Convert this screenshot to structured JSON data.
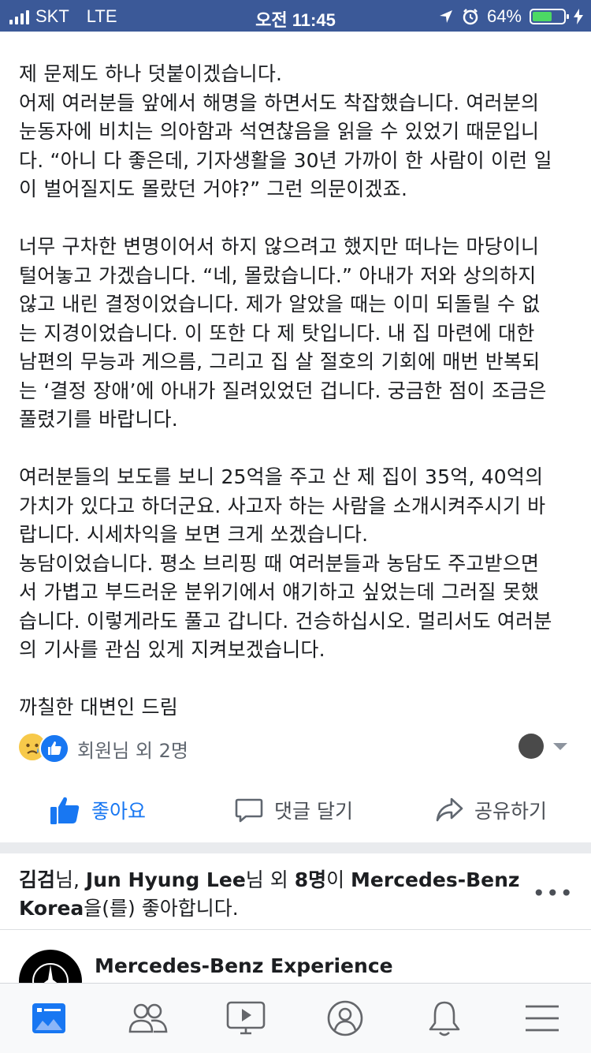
{
  "status_bar": {
    "carrier": "SKT",
    "network": "LTE",
    "time": "오전 11:45",
    "battery_percent": "64%",
    "battery_level": 0.64
  },
  "post": {
    "lines": [
      "제 문제도 하나 덧붙이겠습니다.",
      "어제 여러분들 앞에서 해명을 하면서도 착잡했습니다. 여러분의",
      "눈동자에 비치는 의아함과 석연찮음을 읽을 수 있었기 때문입니",
      "다. “아니 다 좋은데, 기자생활을 30년 가까이 한 사람이 이런 일",
      "이 벌어질지도 몰랐던 거야?” 그런 의문이겠죠.",
      "",
      "너무 구차한 변명이어서 하지 않으려고 했지만 떠나는 마당이니",
      "털어놓고 가겠습니다. “네, 몰랐습니다.” 아내가 저와 상의하지",
      "않고 내린 결정이었습니다. 제가 알았을 때는 이미 되돌릴 수 없",
      "는 지경이었습니다. 이 또한 다 제 탓입니다. 내 집 마련에 대한",
      "남편의 무능과 게으름, 그리고 집 살 절호의 기회에 매번 반복되",
      "는 ‘결정 장애’에 아내가 질려있었던 겁니다. 궁금한 점이 조금은",
      "풀렸기를 바랍니다.",
      "",
      "여러분들의 보도를 보니 25억을 주고 산 제 집이 35억, 40억의",
      "가치가 있다고 하더군요. 사고자 하는 사람을 소개시켜주시기 바",
      "랍니다. 시세차익을 보면 크게 쏘겠습니다.",
      "농담이었습니다. 평소 브리핑 때 여러분들과 농담도 주고받으면",
      "서 가볍고 부드러운 분위기에서 얘기하고 싶었는데 그러질 못했",
      "습니다. 이렇게라도 풀고 갑니다. 건승하십시오. 멀리서도 여러분",
      "의 기사를 관심 있게 지켜보겠습니다.",
      "",
      "까칠한 대변인 드림"
    ]
  },
  "reactions": {
    "summary": "회원님 외 2명",
    "icons": [
      "sad-reaction-icon",
      "like-reaction-icon"
    ]
  },
  "actions": {
    "like": "좋아요",
    "comment": "댓글 달기",
    "share": "공유하기"
  },
  "story": {
    "friend1": "김검",
    "suffix1": "님, ",
    "friend2": "Jun Hyung Lee",
    "suffix2": "님 외 ",
    "others": "8명",
    "suffix3": "이 ",
    "page1": "Mercedes-Benz",
    "page2": "Korea",
    "suffix4": "을(를) 좋아합니다.",
    "more": "•••"
  },
  "page": {
    "name": "Mercedes-Benz Experience"
  },
  "tab_bar": {
    "tabs": [
      "news-feed",
      "friends",
      "watch",
      "profile",
      "notifications",
      "menu"
    ],
    "active": "news-feed",
    "accent": "#1877f2"
  },
  "colors": {
    "status_bar_bg": "#3b5998",
    "link_blue": "#1877f2",
    "text": "#1c1e21",
    "muted": "#606770"
  }
}
